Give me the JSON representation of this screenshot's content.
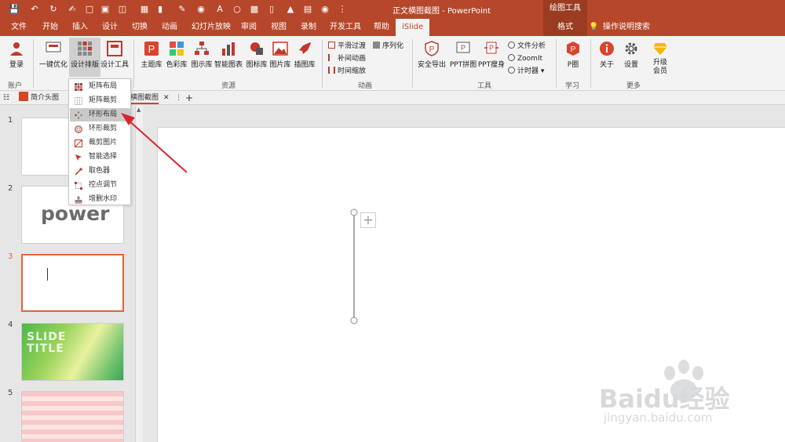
{
  "window": {
    "title": "正文横图截图 - PowerPoint",
    "drawing_tools": "绘图工具"
  },
  "tabs": [
    "文件",
    "开始",
    "插入",
    "设计",
    "切换",
    "动画",
    "幻灯片放映",
    "审阅",
    "视图",
    "录制",
    "开发工具",
    "帮助",
    "iSlide",
    "格式"
  ],
  "tell_me": "操作说明搜索",
  "ribbon": {
    "login": "登录",
    "account_group": "账户",
    "optimize": "一键优化",
    "design_layout": "设计排版",
    "design_tools": "设计工具",
    "theme_lib": "主题库",
    "color_lib": "色彩库",
    "diagram_lib": "图示库",
    "smart_chart": "智能图表",
    "icon_lib": "图标库",
    "picture_lib": "图片库",
    "illustration_lib": "插图库",
    "resources_group": "资源",
    "smooth_transition": "平滑过渡",
    "sequence": "序列化",
    "tween_anim": "补间动画",
    "time_zoom": "时间缩放",
    "animation_group": "动画",
    "safe_export": "安全导出",
    "ppt_puzzle": "PPT拼图",
    "ppt_slim": "PPT瘦身",
    "file_analysis": "文件分析",
    "zoomit": "ZoomIt",
    "timer": "计时器",
    "tools_group": "工具",
    "p_circle": "P圈",
    "learn_group": "学习",
    "about": "关于",
    "settings": "设置",
    "upgrade": "升级会员",
    "more_group": "更多"
  },
  "doc_tabs": {
    "tab1": "简介头图",
    "tab2": "横图截图"
  },
  "dropdown": {
    "items": [
      "矩阵布局",
      "矩阵裁剪",
      "环形布局",
      "环形裁剪",
      "裁剪图片",
      "智能选择",
      "取色器",
      "控点调节",
      "增删水印"
    ],
    "highlighted": 2
  },
  "slides": {
    "numbers": [
      "1",
      "2",
      "3",
      "4",
      "5"
    ],
    "thumb2_text": "power",
    "thumb4_text": "SLIDE TITLE",
    "active": 3
  },
  "watermark": {
    "brand": "Baidu经验",
    "url": "jingyan.baidu.com"
  },
  "colors": {
    "accent": "#b7472a",
    "arrow": "#d9262c",
    "slide_active_border": "#e0643a"
  }
}
